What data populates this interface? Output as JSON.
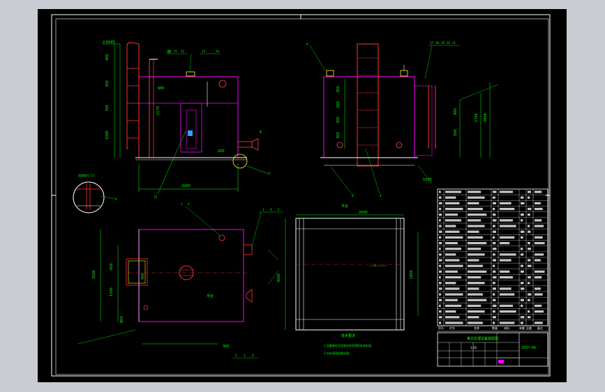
{
  "drawing": {
    "views": {
      "front": {
        "top_callout": "2-6X45",
        "part_numbers_top": [
          "10",
          "11",
          "12",
          "13",
          "14"
        ],
        "right_callouts": [
          "6",
          "7"
        ],
        "bottom_callout": "15",
        "overall_width": "3260",
        "left_dims": [
          "400",
          "350",
          "700",
          "1000"
        ],
        "inner_dims": [
          "680",
          "1170",
          "2270",
          "450",
          "200",
          "800"
        ]
      },
      "side": {
        "part_numbers_top": [
          "17",
          "18",
          "19",
          "20",
          "21"
        ],
        "left_callout": "9",
        "bottom_callouts": [
          "8",
          "4"
        ],
        "right_dims": [
          "900",
          "500",
          "1700",
          "2800"
        ],
        "left_dims": [
          "300",
          "300",
          "300",
          "300"
        ],
        "width_dim": "1000"
      },
      "detail": {
        "label": "局部放大 5:1",
        "callout": "4"
      },
      "plan": {
        "top_callouts": [
          "3",
          "4",
          "5"
        ],
        "left_callouts": [
          "1",
          "2"
        ],
        "dims": [
          "2000",
          "1500",
          "600",
          "800",
          "400",
          "300"
        ],
        "center_label": "平台",
        "bottom_callouts": [
          "2",
          "3",
          "4"
        ]
      },
      "top_view": {
        "title": "平台",
        "width_dim": "2600",
        "left_dim": "3000",
        "right_dim": "1800",
        "callout": "1"
      }
    },
    "tech_requirements": {
      "title": "技术要求",
      "line1": "1.设备制作及验收应符合国家有关标准,",
      "line2": "2.内外表面防腐处理。"
    },
    "parts_table": {
      "rows_count": 24,
      "headers": [
        "序号",
        "代号",
        "名称",
        "数量",
        "材料",
        "单重",
        "总重",
        "备注"
      ]
    },
    "title_block": {
      "name": "某水处理设备装配图",
      "drawing_no": "2007-06",
      "scale": "1:20"
    }
  }
}
